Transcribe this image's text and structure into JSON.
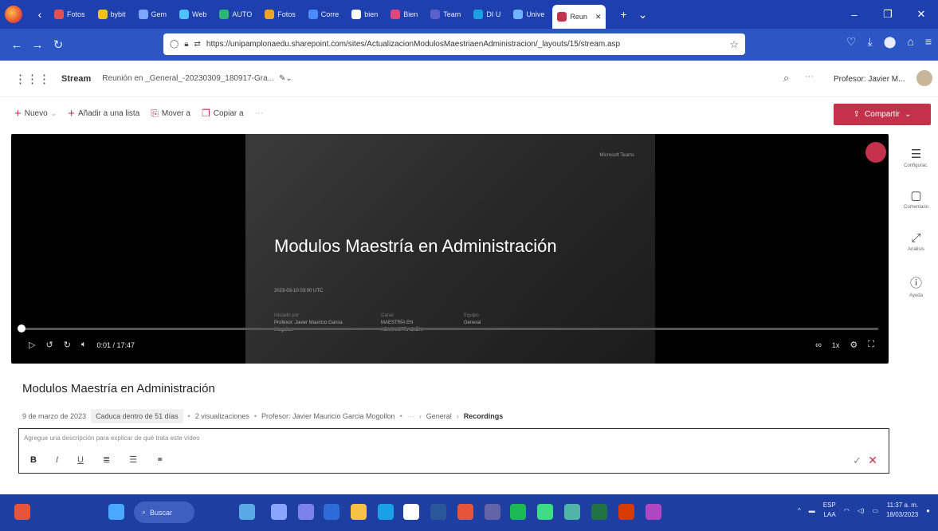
{
  "browser": {
    "tabs": [
      {
        "label": "Fotos",
        "color": "#e84f4f"
      },
      {
        "label": "bybit",
        "color": "#f1c21b"
      },
      {
        "label": "Gem",
        "color": "#7ba7ff"
      },
      {
        "label": "Web",
        "color": "#4ec1ff"
      },
      {
        "label": "AUTO",
        "color": "#2bb673"
      },
      {
        "label": "Fotos",
        "color": "#f0a32a"
      },
      {
        "label": "Corre",
        "color": "#4a8cff"
      },
      {
        "label": "bien",
        "color": "#ffffff"
      },
      {
        "label": "Bien",
        "color": "#e0467c"
      },
      {
        "label": "Team",
        "color": "#5b5fc7"
      },
      {
        "label": "DI U",
        "color": "#1ba1e2"
      },
      {
        "label": "Unive",
        "color": "#6fb3ff"
      },
      {
        "label": "Reun",
        "color": "#c4314b",
        "active": true
      }
    ],
    "url": "https://unipamplonaedu.sharepoint.com/sites/ActualizacionModulosMaestriaenAdministracion/_layouts/15/stream.asp"
  },
  "app": {
    "name": "Stream",
    "breadcrumb": "Reunión en _General_-20230309_180917-Gra...",
    "user": "Profesor: Javier M..."
  },
  "commands": {
    "new": "Nuevo",
    "add_list": "Añadir a una lista",
    "move": "Mover a",
    "copy": "Copiar a",
    "share": "Compartir"
  },
  "video": {
    "slide_brand": "Microsoft Teams",
    "slide_title": "Modulos Maestría en Administración",
    "slide_date": "2023-03-10 03:00 UTC",
    "slide_meta": [
      {
        "key": "Iniciado por",
        "value": "Profesor: Javier Mauricio Garcia Mogollon"
      },
      {
        "key": "Canal",
        "value": "MAESTRÍA EN ADMINISTRACIÓN"
      },
      {
        "key": "Equipo",
        "value": "General"
      }
    ],
    "time": "0:01 / 17:47",
    "speed": "1x",
    "progress_fraction": 0.001
  },
  "rail": {
    "config": "Configurac.",
    "comments": "Comentario",
    "analytics": "Análisis",
    "help": "Ayuda"
  },
  "info": {
    "title": "Modulos Maestría en Administración",
    "date": "9 de marzo de 2023",
    "expires": "Caduca dentro de 51 días",
    "views": "2 visualizaciones",
    "owner": "Profesor: Javier Mauricio Garcia Mogollon",
    "path_channel": "General",
    "path_folder": "Recordings",
    "description_placeholder": "Agregue una descripción para explicar de qué trata este vídeo"
  },
  "taskbar": {
    "search": "Buscar",
    "lang_top": "ESP",
    "lang_bottom": "LAA",
    "time": "11:37 a. m.",
    "date": "18/03/2023"
  }
}
